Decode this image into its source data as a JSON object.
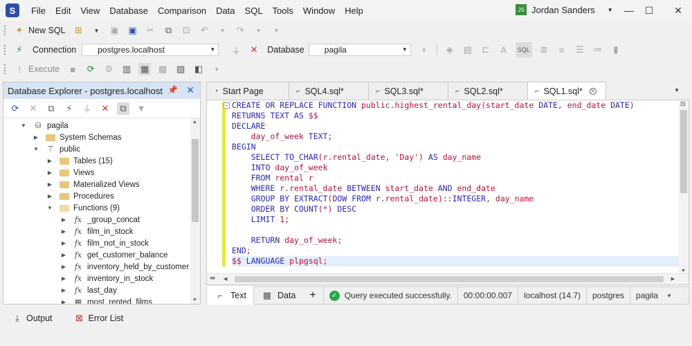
{
  "app": {
    "name": "dbForge Studio for PostgreSQL",
    "logo_letter": "S"
  },
  "menu": [
    "File",
    "Edit",
    "View",
    "Database",
    "Comparison",
    "Data",
    "SQL",
    "Tools",
    "Window",
    "Help"
  ],
  "user": {
    "initials": "JS",
    "name": "Jordan Sanders"
  },
  "toolbar1": {
    "new_sql_label": "New SQL"
  },
  "toolbar2": {
    "connection_label": "Connection",
    "connection_value": "postgres.localhost",
    "database_label": "Database",
    "database_value": "pagila"
  },
  "toolbar3": {
    "execute_label": "Execute"
  },
  "explorer": {
    "title": "Database Explorer - postgres.localhost",
    "tree": [
      {
        "label": "pagila",
        "icon": "database-icon",
        "toggle": "expanded"
      },
      {
        "label": "System Schemas",
        "icon": "folder-icon",
        "toggle": "collapsed"
      },
      {
        "label": "public",
        "icon": "schema-icon",
        "toggle": "expanded"
      },
      {
        "label": "Tables (15)",
        "icon": "folder-icon",
        "toggle": "collapsed"
      },
      {
        "label": "Views",
        "icon": "folder-icon",
        "toggle": "collapsed"
      },
      {
        "label": "Materialized Views",
        "icon": "folder-icon",
        "toggle": "collapsed"
      },
      {
        "label": "Procedures",
        "icon": "folder-icon",
        "toggle": "collapsed"
      },
      {
        "label": "Functions (9)",
        "icon": "folder-open-icon",
        "toggle": "expanded"
      },
      {
        "label": "_group_concat",
        "icon": "function-icon",
        "toggle": "collapsed"
      },
      {
        "label": "film_in_stock",
        "icon": "function-icon",
        "toggle": "collapsed"
      },
      {
        "label": "film_not_in_stock",
        "icon": "function-icon",
        "toggle": "collapsed"
      },
      {
        "label": "get_customer_balance",
        "icon": "function-icon",
        "toggle": "collapsed"
      },
      {
        "label": "inventory_held_by_customer",
        "icon": "function-icon",
        "toggle": "collapsed"
      },
      {
        "label": "inventory_in_stock",
        "icon": "function-icon",
        "toggle": "collapsed"
      },
      {
        "label": "last_day",
        "icon": "function-icon",
        "toggle": "collapsed"
      },
      {
        "label": "most_rented_films",
        "icon": "table-function-icon",
        "toggle": "collapsed"
      }
    ]
  },
  "tabs": [
    {
      "label": "Start Page",
      "active": false
    },
    {
      "label": "SQL4.sql*",
      "active": false
    },
    {
      "label": "SQL3.sql*",
      "active": false
    },
    {
      "label": "SQL2.sql*",
      "active": false
    },
    {
      "label": "SQL1.sql*",
      "active": true
    }
  ],
  "code_lines": [
    "CREATE OR REPLACE FUNCTION public.highest_rental_day(start_date DATE, end_date DATE)",
    "RETURNS TEXT AS $$",
    "DECLARE",
    "    day_of_week TEXT;",
    "BEGIN",
    "    SELECT TO_CHAR(r.rental_date, 'Day') AS day_name",
    "    INTO day_of_week",
    "    FROM rental r",
    "    WHERE r.rental_date BETWEEN start_date AND end_date",
    "    GROUP BY EXTRACT(DOW FROM r.rental_date)::INTEGER, day_name",
    "    ORDER BY COUNT(*) DESC",
    "    LIMIT 1;",
    "",
    "    RETURN day_of_week;",
    "END;",
    "$$ LANGUAGE plpgsql;"
  ],
  "status": {
    "text_tab": "Text",
    "data_tab": "Data",
    "add": "+",
    "message": "Query executed successfully.",
    "duration": "00:00:00.007",
    "server": "localhost (14.7)",
    "user": "postgres",
    "database": "pagila"
  },
  "bottom": {
    "output_label": "Output",
    "error_list_label": "Error List"
  }
}
